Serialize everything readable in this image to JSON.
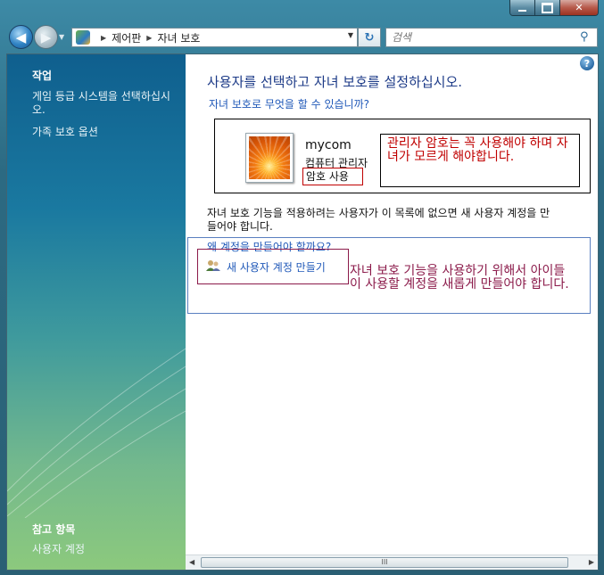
{
  "window": {
    "caption_buttons": [
      "minimize",
      "maximize",
      "close"
    ]
  },
  "nav": {
    "breadcrumb": [
      "제어판",
      "자녀 보호"
    ],
    "search_placeholder": "검색",
    "icons": [
      "back-arrow-icon",
      "forward-arrow-icon",
      "refresh-icon",
      "search-icon"
    ]
  },
  "sidebar": {
    "tasks_heading": "작업",
    "tasks": [
      "게임 등급 시스템을 선택하십시오.",
      "가족 보호 옵션"
    ],
    "see_also_heading": "참고 항목",
    "see_also": [
      "사용자 계정"
    ]
  },
  "main": {
    "title": "사용자를 선택하고 자녀 보호를 설정하십시오.",
    "question_link": "자녀 보호로 무엇을 할 수 있습니까?",
    "account": {
      "name": "mycom",
      "role": "컴퓨터 관리자",
      "password_status": "암호 사용"
    },
    "note_admin": "관리자 암호는 꼭 사용해야 하며 자녀가 모르게 해야합니다.",
    "info_text": "자녀 보호 기능을 적용하려는 사용자가 이 목록에 없으면 새 사용자 계정을 만들어야 합니다.",
    "why_link": "왜 계정을 만들어야 할까요?",
    "create_link": "새 사용자 계정 만들기",
    "note_create": "자녀 보호 기능을 사용하기 위해서 아이들이 사용할 계정을 새롭게 만들어야 합니다.",
    "scrollbar_grip": "III"
  },
  "colors": {
    "title_text": "#1c3a87",
    "link": "#1f58b8",
    "annotation_red": "#c00000",
    "annotation_maroon": "#8b1a4a"
  }
}
